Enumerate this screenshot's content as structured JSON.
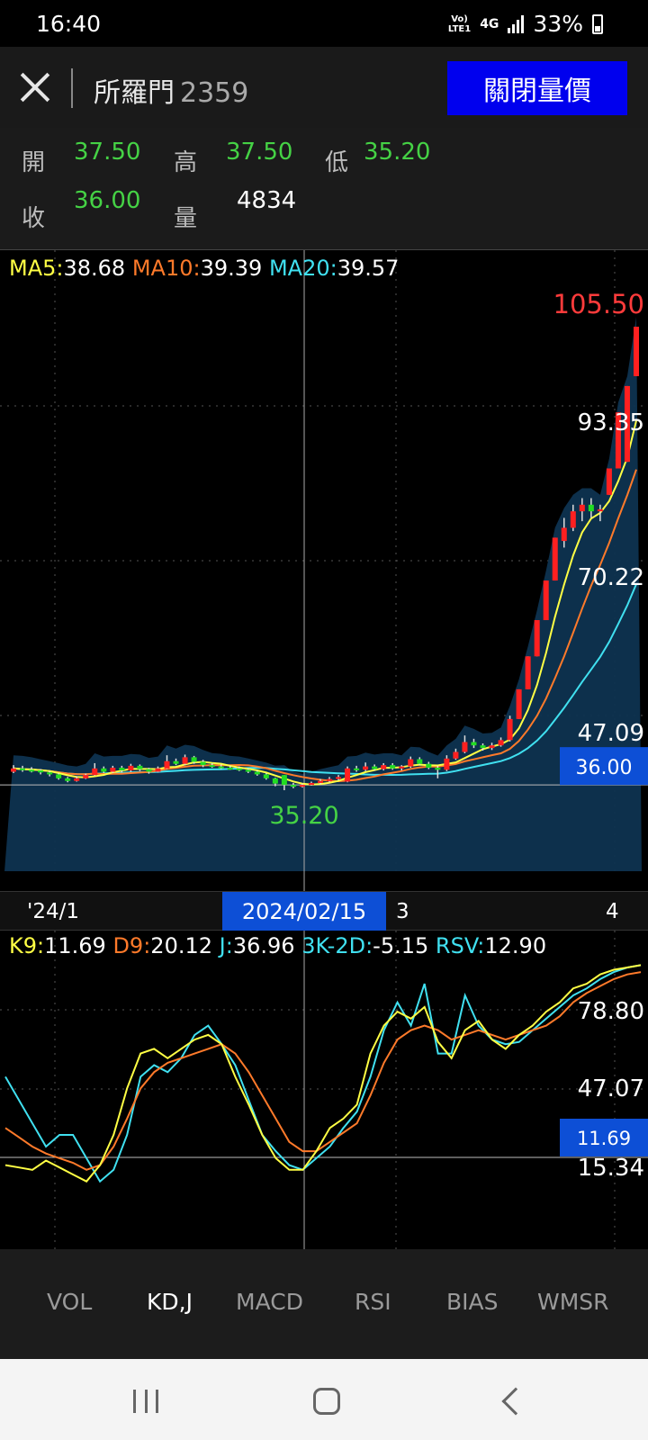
{
  "status": {
    "time": "16:40",
    "network": [
      "Vo)",
      "LTE1"
    ],
    "network_type": "4G",
    "battery": "33%"
  },
  "header": {
    "stock_name": "所羅門",
    "stock_code": "2359",
    "close_pv_label": "關閉量價"
  },
  "quote": {
    "open_label": "開",
    "open": "37.50",
    "high_label": "高",
    "high": "37.50",
    "low_label": "低",
    "low": "35.20",
    "close_label": "收",
    "close": "36.00",
    "volume_label": "量",
    "volume": "4834"
  },
  "ma": {
    "ma5_label": "MA5:",
    "ma5": "38.68",
    "ma10_label": "MA10:",
    "ma10": "39.39",
    "ma20_label": "MA20:",
    "ma20": "39.57"
  },
  "price_axis": {
    "max": "105.50",
    "t1": "93.35",
    "t2": "70.22",
    "t3": "47.09",
    "current": "36.00",
    "min_marker": "35.20"
  },
  "date_axis": {
    "d1": "'24/1",
    "selected": "2024/02/15",
    "d2": "3",
    "d3": "4"
  },
  "kd": {
    "k_label": "K9:",
    "k": "11.69",
    "d_label": "D9:",
    "d": "20.12",
    "j_label": "J:",
    "j": "36.96",
    "kd2_label": "3K-2D:",
    "kd2": "-5.15",
    "rsv_label": "RSV:",
    "rsv": "12.90"
  },
  "kd_axis": {
    "t1": "78.80",
    "t2": "47.07",
    "t3": "15.34",
    "current": "11.69"
  },
  "tabs": [
    "VOL",
    "KD,J",
    "MACD",
    "RSI",
    "BIAS",
    "WMSR"
  ],
  "active_tab": 1,
  "colors": {
    "up": "#ff2020",
    "down": "#22dd22",
    "ma5": "#ffff44",
    "ma10": "#ff7a2a",
    "ma20": "#40e0f0",
    "accent": "#0d4fd6"
  },
  "chart_data": [
    {
      "type": "candlestick",
      "title": "",
      "ylim": [
        30,
        110
      ],
      "candles": [
        {
          "o": 38.0,
          "c": 38.5,
          "h": 39.0,
          "l": 37.8
        },
        {
          "o": 38.5,
          "c": 38.3,
          "h": 38.9,
          "l": 38.0
        },
        {
          "o": 38.3,
          "c": 38.2,
          "h": 38.7,
          "l": 37.9
        },
        {
          "o": 38.2,
          "c": 37.9,
          "h": 38.4,
          "l": 37.6
        },
        {
          "o": 37.9,
          "c": 37.6,
          "h": 38.1,
          "l": 37.3
        },
        {
          "o": 37.6,
          "c": 37.0,
          "h": 37.8,
          "l": 36.8
        },
        {
          "o": 37.0,
          "c": 36.6,
          "h": 37.2,
          "l": 36.4
        },
        {
          "o": 36.6,
          "c": 37.0,
          "h": 37.3,
          "l": 36.5
        },
        {
          "o": 37.0,
          "c": 37.5,
          "h": 37.7,
          "l": 36.9
        },
        {
          "o": 37.5,
          "c": 38.5,
          "h": 39.3,
          "l": 37.4
        },
        {
          "o": 38.5,
          "c": 38.0,
          "h": 38.8,
          "l": 37.8
        },
        {
          "o": 38.0,
          "c": 38.6,
          "h": 38.9,
          "l": 37.8
        },
        {
          "o": 38.6,
          "c": 38.2,
          "h": 38.9,
          "l": 37.9
        },
        {
          "o": 38.2,
          "c": 38.9,
          "h": 39.2,
          "l": 38.0
        },
        {
          "o": 38.9,
          "c": 38.4,
          "h": 39.1,
          "l": 38.1
        },
        {
          "o": 38.4,
          "c": 38.0,
          "h": 38.6,
          "l": 37.7
        },
        {
          "o": 38.0,
          "c": 38.5,
          "h": 38.8,
          "l": 37.9
        },
        {
          "o": 38.5,
          "c": 39.6,
          "h": 40.5,
          "l": 38.4
        },
        {
          "o": 39.6,
          "c": 39.2,
          "h": 40.0,
          "l": 39.0
        },
        {
          "o": 39.2,
          "c": 40.2,
          "h": 40.6,
          "l": 39.0
        },
        {
          "o": 40.2,
          "c": 39.5,
          "h": 40.4,
          "l": 39.2
        },
        {
          "o": 39.5,
          "c": 39.0,
          "h": 39.8,
          "l": 38.7
        },
        {
          "o": 39.0,
          "c": 38.8,
          "h": 39.3,
          "l": 38.6
        },
        {
          "o": 38.8,
          "c": 38.6,
          "h": 39.1,
          "l": 38.4
        },
        {
          "o": 38.6,
          "c": 38.5,
          "h": 38.9,
          "l": 38.3
        },
        {
          "o": 38.5,
          "c": 38.3,
          "h": 38.8,
          "l": 38.1
        },
        {
          "o": 38.3,
          "c": 38.0,
          "h": 38.5,
          "l": 37.8
        },
        {
          "o": 38.0,
          "c": 37.6,
          "h": 38.2,
          "l": 37.4
        },
        {
          "o": 37.6,
          "c": 37.0,
          "h": 37.8,
          "l": 36.8
        },
        {
          "o": 37.0,
          "c": 36.2,
          "h": 37.1,
          "l": 35.8
        },
        {
          "o": 37.5,
          "c": 36.0,
          "h": 37.5,
          "l": 35.2
        },
        {
          "o": 36.0,
          "c": 35.8,
          "h": 36.3,
          "l": 35.5
        },
        {
          "o": 35.8,
          "c": 36.0,
          "h": 36.2,
          "l": 35.6
        },
        {
          "o": 36.0,
          "c": 36.3,
          "h": 36.5,
          "l": 35.9
        },
        {
          "o": 36.3,
          "c": 36.6,
          "h": 36.9,
          "l": 36.1
        },
        {
          "o": 36.6,
          "c": 36.9,
          "h": 37.2,
          "l": 36.4
        },
        {
          "o": 36.9,
          "c": 37.2,
          "h": 37.5,
          "l": 36.7
        },
        {
          "o": 36.5,
          "c": 38.5,
          "h": 38.8,
          "l": 36.4
        },
        {
          "o": 38.5,
          "c": 38.3,
          "h": 38.9,
          "l": 38.0
        },
        {
          "o": 38.3,
          "c": 38.8,
          "h": 39.4,
          "l": 38.1
        },
        {
          "o": 38.8,
          "c": 38.4,
          "h": 39.1,
          "l": 38.2
        },
        {
          "o": 38.4,
          "c": 39.0,
          "h": 39.3,
          "l": 38.2
        },
        {
          "o": 39.0,
          "c": 38.5,
          "h": 39.3,
          "l": 38.3
        },
        {
          "o": 38.5,
          "c": 38.8,
          "h": 39.0,
          "l": 38.2
        },
        {
          "o": 38.8,
          "c": 39.9,
          "h": 40.3,
          "l": 38.6
        },
        {
          "o": 39.9,
          "c": 39.2,
          "h": 40.2,
          "l": 39.0
        },
        {
          "o": 39.2,
          "c": 38.6,
          "h": 39.5,
          "l": 38.4
        },
        {
          "o": 38.6,
          "c": 38.3,
          "h": 38.9,
          "l": 37.0
        },
        {
          "o": 38.3,
          "c": 40.0,
          "h": 40.5,
          "l": 38.1
        },
        {
          "o": 40.0,
          "c": 41.0,
          "h": 41.5,
          "l": 39.8
        },
        {
          "o": 41.0,
          "c": 42.5,
          "h": 43.5,
          "l": 40.8
        },
        {
          "o": 42.5,
          "c": 42.0,
          "h": 43.0,
          "l": 41.6
        },
        {
          "o": 42.0,
          "c": 41.6,
          "h": 42.3,
          "l": 41.2
        },
        {
          "o": 41.6,
          "c": 42.0,
          "h": 42.4,
          "l": 41.3
        },
        {
          "o": 42.0,
          "c": 42.8,
          "h": 43.2,
          "l": 41.8
        },
        {
          "o": 42.8,
          "c": 46.0,
          "h": 46.5,
          "l": 42.6
        },
        {
          "o": 46.0,
          "c": 50.5,
          "h": 50.5,
          "l": 46.0
        },
        {
          "o": 50.5,
          "c": 55.5,
          "h": 55.5,
          "l": 50.5
        },
        {
          "o": 55.5,
          "c": 61.0,
          "h": 61.0,
          "l": 55.5
        },
        {
          "o": 61.0,
          "c": 67.0,
          "h": 67.0,
          "l": 61.0
        },
        {
          "o": 67.0,
          "c": 73.5,
          "h": 73.5,
          "l": 67.0
        },
        {
          "o": 73.0,
          "c": 75.0,
          "h": 76.5,
          "l": 72.0
        },
        {
          "o": 75.0,
          "c": 77.5,
          "h": 78.5,
          "l": 74.5
        },
        {
          "o": 77.5,
          "c": 78.5,
          "h": 79.5,
          "l": 76.0
        },
        {
          "o": 78.5,
          "c": 77.5,
          "h": 79.5,
          "l": 76.5
        },
        {
          "o": 77.5,
          "c": 77.8,
          "h": 78.5,
          "l": 76.0
        },
        {
          "o": 80.0,
          "c": 84.0,
          "h": 84.0,
          "l": 80.0
        },
        {
          "o": 84.0,
          "c": 92.5,
          "h": 92.5,
          "l": 84.0
        },
        {
          "o": 85.0,
          "c": 96.5,
          "h": 96.5,
          "l": 85.0
        },
        {
          "o": 98.0,
          "c": 105.5,
          "h": 105.5,
          "l": 98.0
        }
      ]
    },
    {
      "type": "line",
      "title": "",
      "ylim": [
        0,
        100
      ],
      "series": [
        {
          "name": "K9",
          "values": [
            12,
            11,
            10,
            14,
            11,
            8,
            5,
            12,
            25,
            45,
            60,
            62,
            58,
            62,
            66,
            68,
            64,
            50,
            38,
            25,
            15,
            10,
            10,
            18,
            28,
            32,
            38,
            60,
            72,
            78,
            75,
            80,
            65,
            58,
            70,
            74,
            66,
            62,
            68,
            72,
            78,
            82,
            88,
            90,
            94,
            96,
            97,
            98
          ]
        },
        {
          "name": "D9",
          "values": [
            28,
            24,
            20,
            17,
            15,
            13,
            10,
            12,
            20,
            32,
            45,
            52,
            56,
            58,
            60,
            62,
            64,
            60,
            52,
            42,
            32,
            22,
            18,
            18,
            22,
            26,
            30,
            42,
            56,
            66,
            70,
            72,
            70,
            66,
            68,
            70,
            68,
            66,
            68,
            70,
            72,
            76,
            82,
            86,
            89,
            92,
            94,
            95
          ]
        },
        {
          "name": "J",
          "values": [
            50,
            40,
            30,
            20,
            25,
            25,
            15,
            5,
            10,
            25,
            50,
            55,
            52,
            58,
            68,
            72,
            64,
            55,
            40,
            25,
            18,
            12,
            10,
            15,
            20,
            28,
            35,
            50,
            70,
            82,
            72,
            90,
            60,
            60,
            85,
            72,
            66,
            64,
            65,
            70,
            75,
            80,
            85,
            88,
            92,
            95,
            97,
            98
          ]
        }
      ]
    }
  ]
}
